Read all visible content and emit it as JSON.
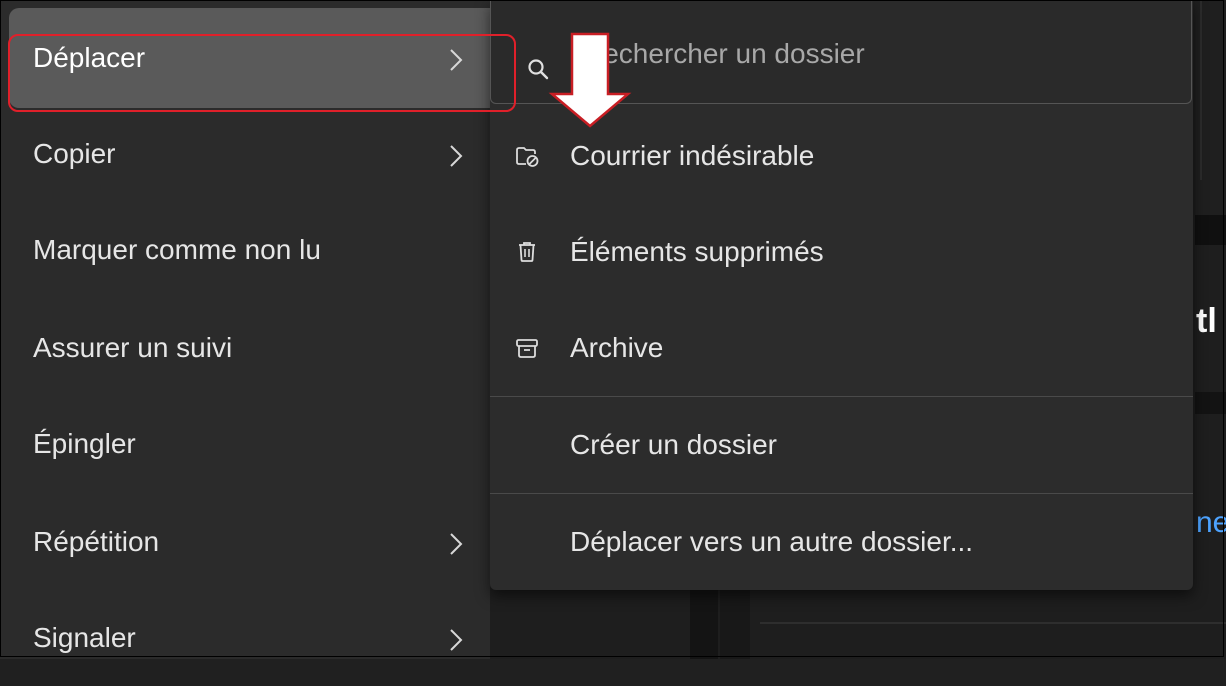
{
  "context_menu": {
    "items": [
      {
        "label": "Déplacer",
        "has_submenu": true,
        "active": true
      },
      {
        "label": "Copier",
        "has_submenu": true
      },
      {
        "label": "Marquer comme non lu",
        "has_submenu": false
      },
      {
        "label": "Assurer un suivi",
        "has_submenu": false
      },
      {
        "label": "Épingler",
        "has_submenu": false
      },
      {
        "label": "Répétition",
        "has_submenu": true
      },
      {
        "label": "Signaler",
        "has_submenu": true
      }
    ]
  },
  "move_submenu": {
    "search": {
      "placeholder": "Rechercher un dossier",
      "icon": "search-icon"
    },
    "folders": [
      {
        "label": "Courrier indésirable",
        "icon": "junk-folder-icon"
      },
      {
        "label": "Éléments supprimés",
        "icon": "trash-icon"
      },
      {
        "label": "Archive",
        "icon": "archive-icon"
      }
    ],
    "actions": {
      "create_folder": "Créer un dossier",
      "move_to_other": "Déplacer vers un autre dossier..."
    }
  },
  "background": {
    "heading_fragment": "tl",
    "link_fragment": "ne"
  },
  "colors": {
    "menu_bg": "#2b2b2b",
    "active_item_bg": "#5a5a5a",
    "highlight_box": "#e0202a",
    "link": "#4da3ff"
  }
}
